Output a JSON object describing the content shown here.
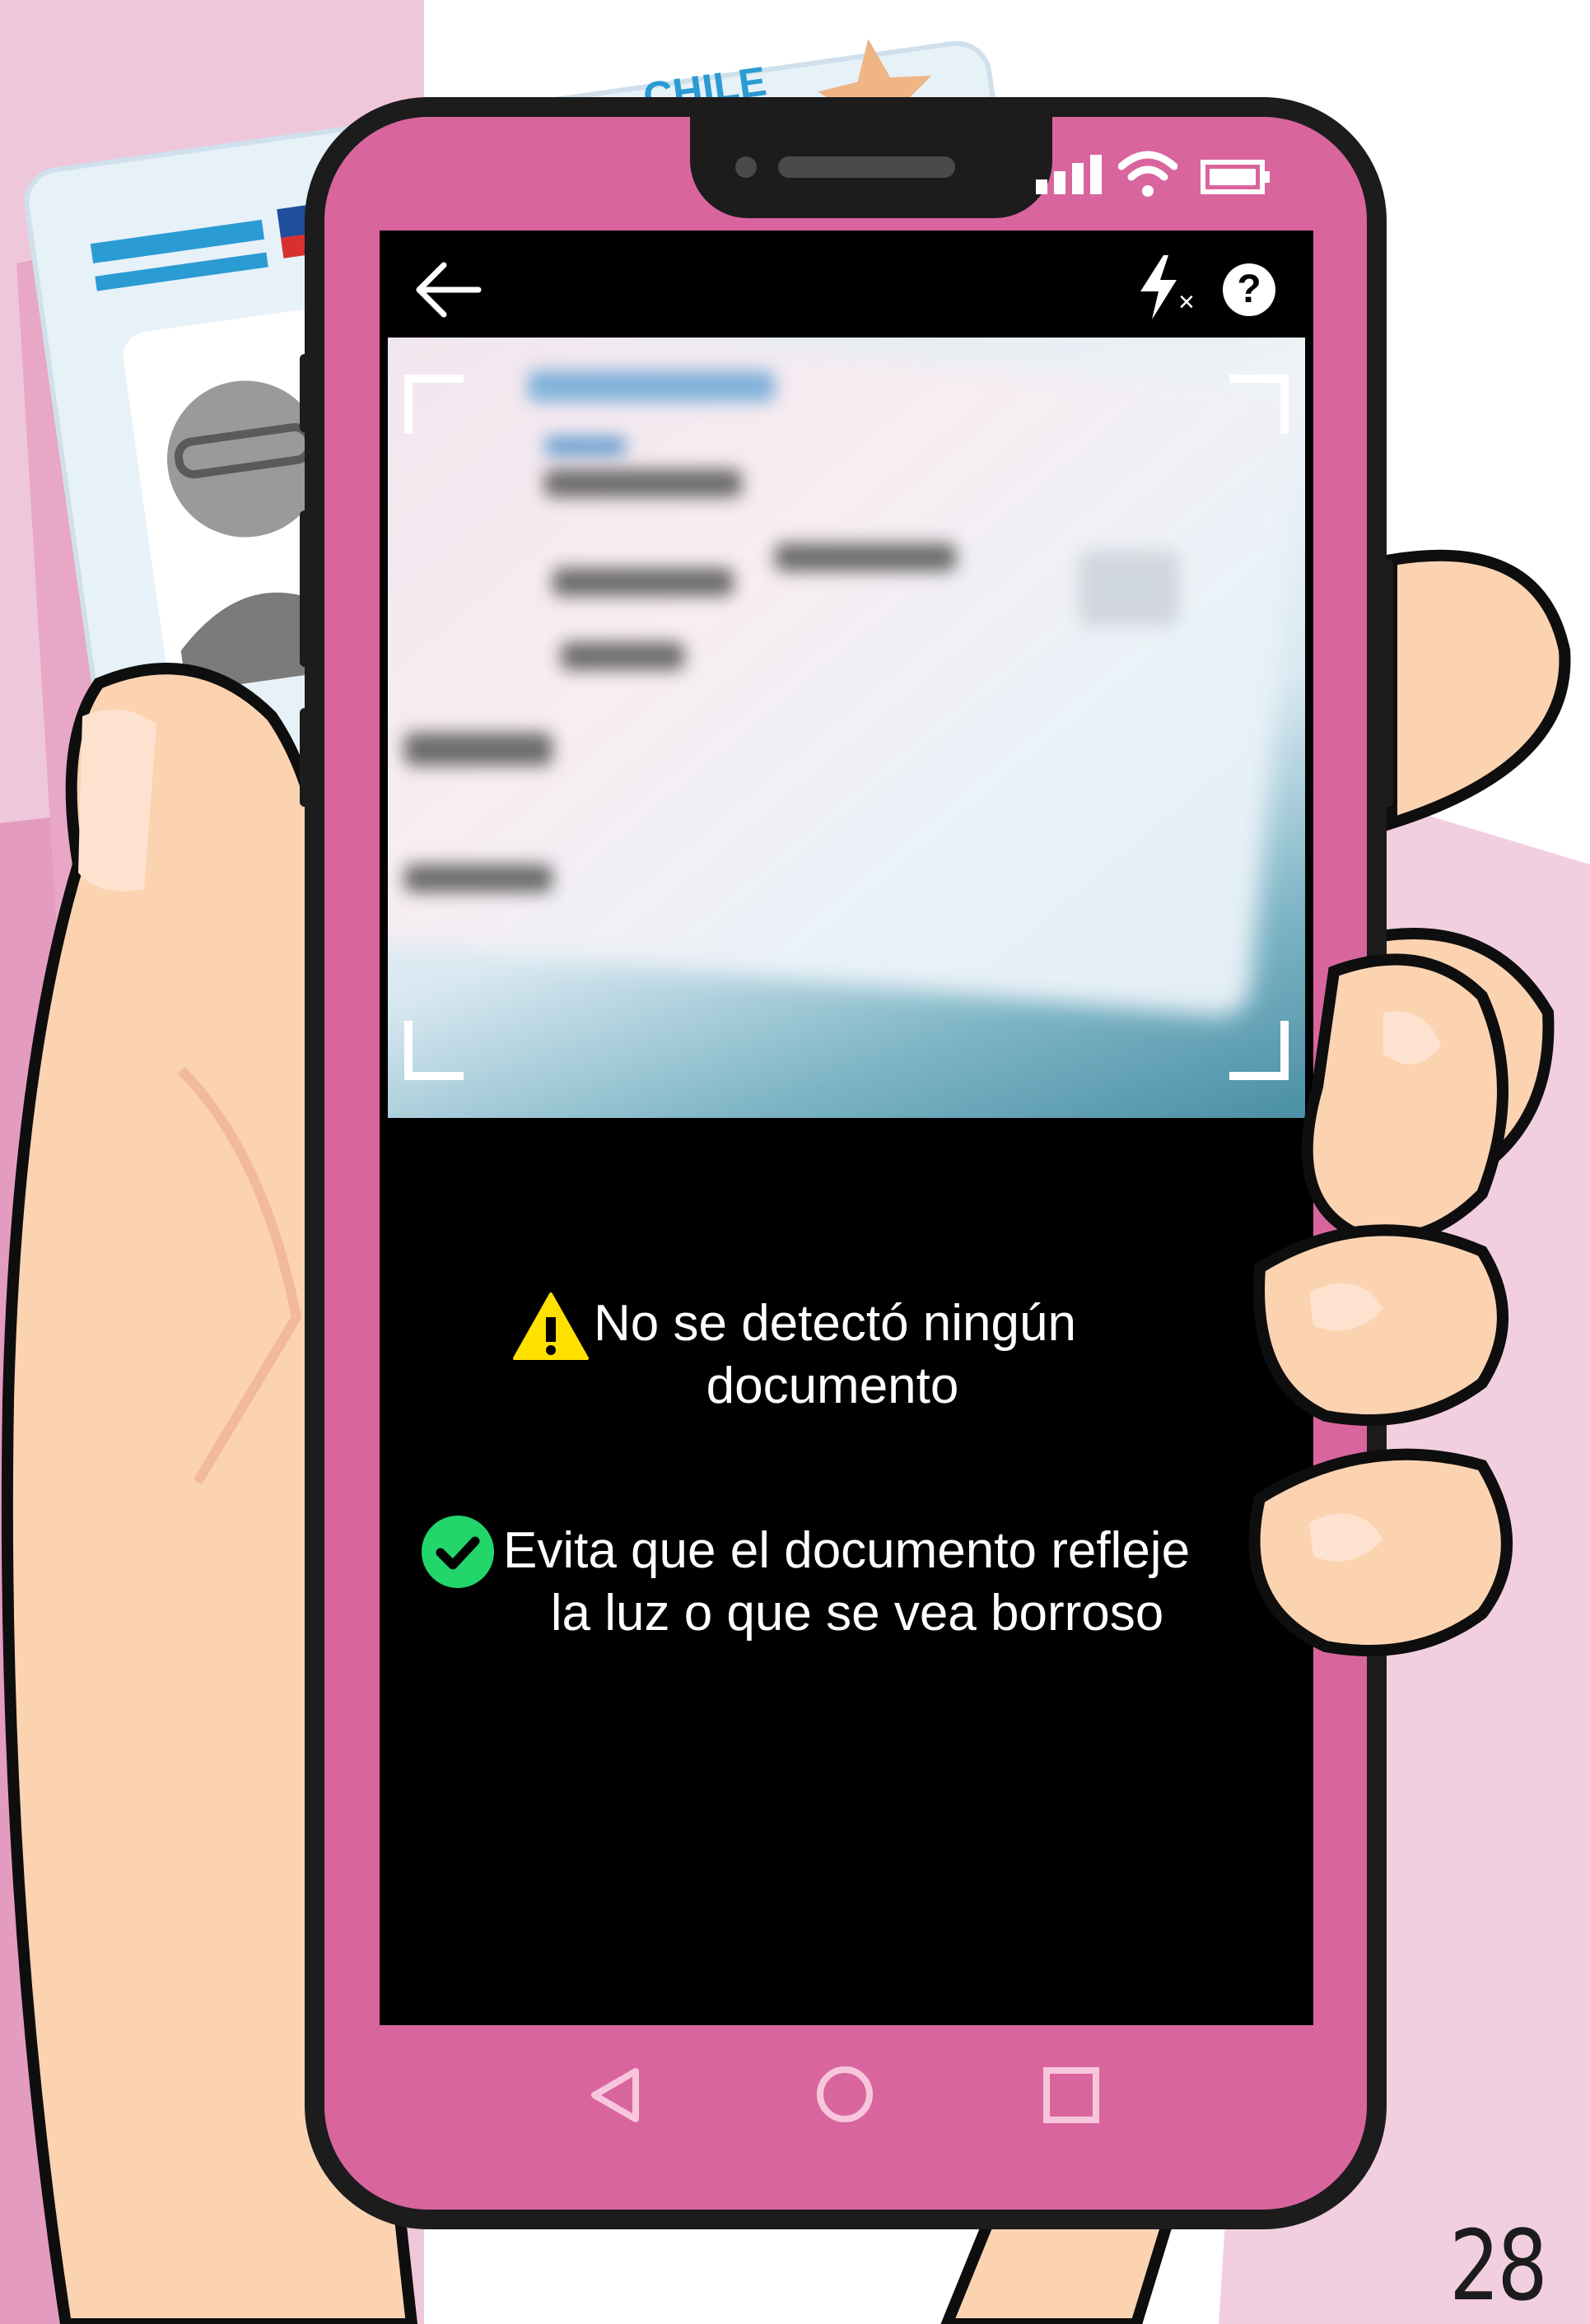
{
  "colors": {
    "phone_frame": "#d9659e",
    "screen_bg": "#000000",
    "warning": "#ffe100",
    "success": "#22d66b"
  },
  "status_bar": {
    "icons": [
      "signal-icon",
      "wifi-icon",
      "battery-icon"
    ]
  },
  "top_bar": {
    "back_icon": "arrow-left-icon",
    "flash_icon": "flash-off-icon",
    "help_icon": "help-icon",
    "help_glyph": "?",
    "flash_off_mark": "×"
  },
  "camera": {
    "blurred_card_text": "REPÚBLICA DE CHILE"
  },
  "messages": {
    "warning_line1": "No se detectó ningún",
    "warning_line2": "documento",
    "tip_line1": "Evita que el documento refleje",
    "tip_line2": "la luz o que se vea borroso"
  },
  "nav_bar": {
    "back": "triangle-back-icon",
    "home": "circle-home-icon",
    "recents": "square-recents-icon"
  },
  "background_card": {
    "country_text": "CHILE"
  },
  "page": {
    "number": "28"
  }
}
